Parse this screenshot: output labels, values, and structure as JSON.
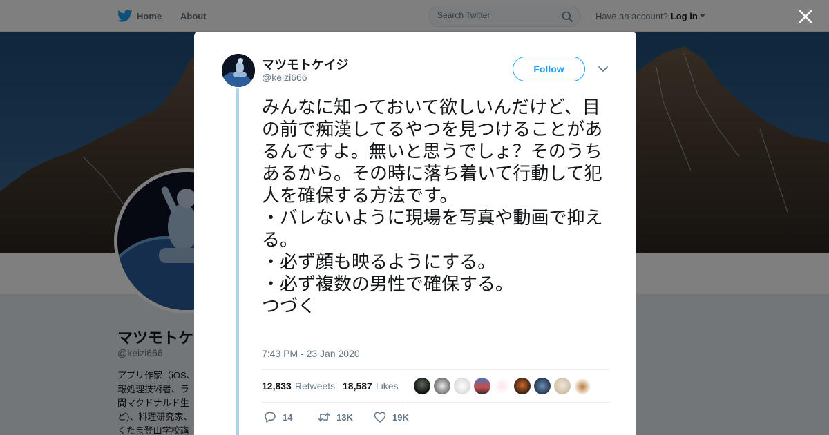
{
  "topbar": {
    "home_label": "Home",
    "about_label": "About",
    "search_placeholder": "Search Twitter",
    "have_account": "Have an account?",
    "login_label": "Log in"
  },
  "profile": {
    "name": "マツモトケイ",
    "handle": "@keizi666",
    "bio_lines": [
      "アプリ作家（iOS、",
      "報処理技術者、ラ",
      "間マクドナルド生",
      "ど)、料理研究家、",
      "くたま登山学校講"
    ]
  },
  "tweet": {
    "author_name": "マツモトケイジ",
    "author_handle": "@keizi666",
    "follow_label": "Follow",
    "text": "みんなに知っておいて欲しいんだけど、目の前で痴漢してるやつを見つけることがあるんですよ。無いと思うでしょ？そのうちあるから。その時に落ち着いて行動して犯人を確保する方法です。\n・バレないように現場を写真や動画で抑える。\n・必ず顔も映るようにする。\n・必ず複数の男性で確保する。\nつづく",
    "timestamp": "7:43 PM - 23 Jan 2020",
    "retweets_count": "12,833",
    "retweets_label": "Retweets",
    "likes_count": "18,587",
    "likes_label": "Likes",
    "replies": "14",
    "retweets_short": "13K",
    "likes_short": "19K"
  },
  "colors": {
    "accent": "#1da1f2",
    "thread_line": "#a9d4f2",
    "text_primary": "#14171a",
    "text_secondary": "#657786"
  },
  "icons": [
    "twitter-bird-icon",
    "search-icon",
    "close-icon",
    "chevron-down-icon",
    "reply-icon",
    "retweet-icon",
    "heart-icon"
  ]
}
